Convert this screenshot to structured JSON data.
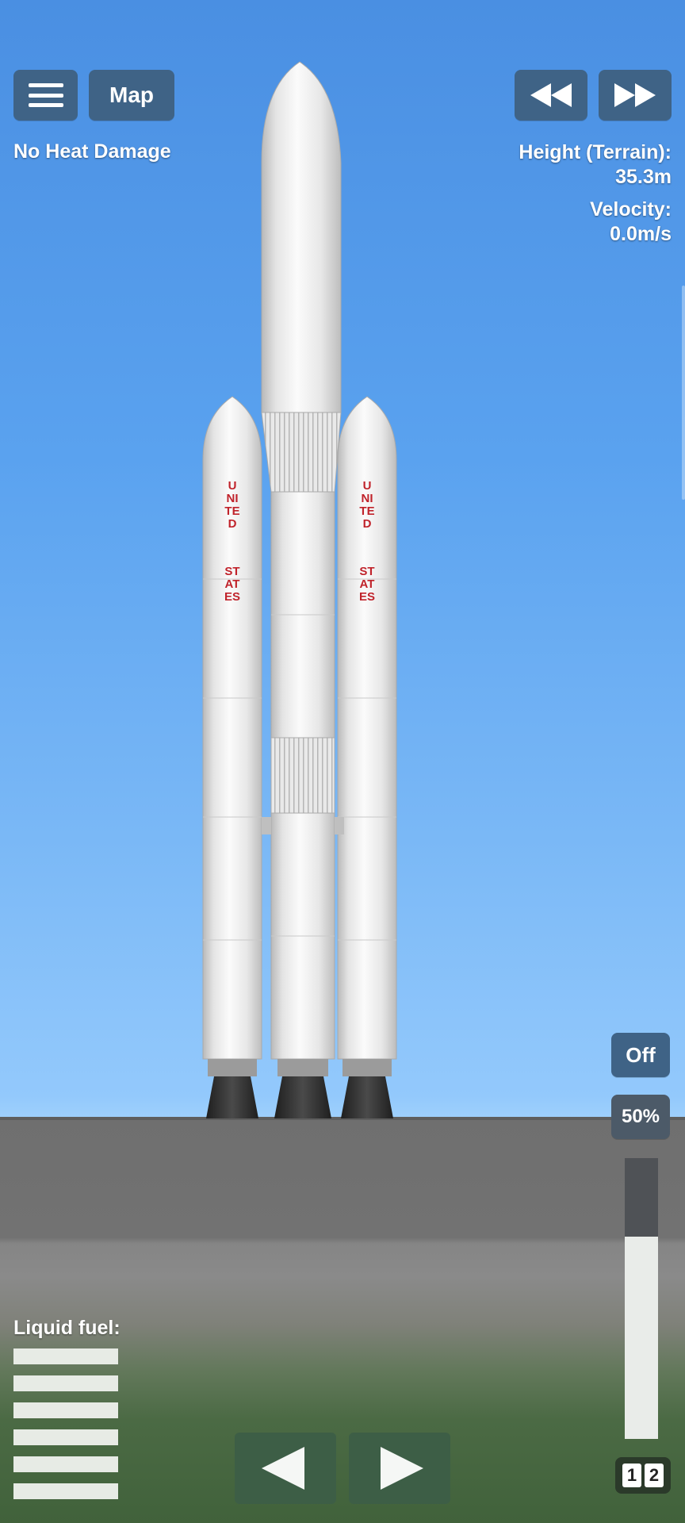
{
  "top_bar": {
    "menu_icon": "hamburger-menu-icon",
    "map_label": "Map",
    "rewind_icon": "rewind-icon",
    "fast_forward_icon": "fast-forward-icon"
  },
  "status": {
    "heat": "No Heat Damage",
    "height_label": "Height (Terrain):",
    "height_value": "35.3m",
    "velocity_label": "Velocity:",
    "velocity_value": "0.0m/s"
  },
  "rocket": {
    "booster_text_line1": "UNITED",
    "booster_text_line2": "STATES"
  },
  "controls": {
    "off_label": "Off",
    "percent_label": "50%",
    "throttle_level": 0.72,
    "throttle_icon": "throttle-slider",
    "left_icon": "rotate-left-icon",
    "right_icon": "rotate-right-icon",
    "stage_digits": [
      "1",
      "2"
    ]
  },
  "fuel": {
    "label": "Liquid fuel:",
    "bar_count": 6
  },
  "colors": {
    "button": "#3f6386",
    "livery_text": "#c0232b"
  }
}
